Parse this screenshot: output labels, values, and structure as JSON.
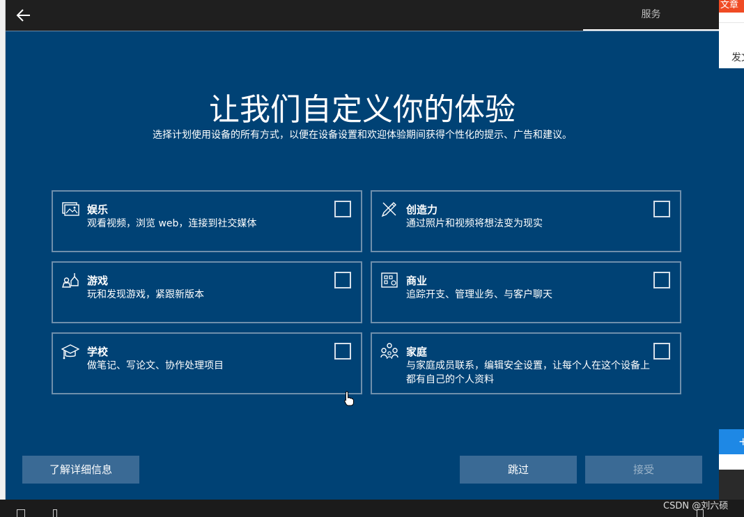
{
  "topbar": {
    "back_icon": "back-arrow-icon",
    "tab_label": "服务"
  },
  "oobe": {
    "title": "让我们自定义你的体验",
    "subtitle": "选择计划使用设备的所有方式，以便在设备设置和欢迎体验期间获得个性化的提示、广告和建议。",
    "cards": [
      {
        "icon": "entertainment-icon",
        "title": "娱乐",
        "desc": "观看视频，浏览 web，连接到社交媒体",
        "checked": false
      },
      {
        "icon": "creativity-icon",
        "title": "创造力",
        "desc": "通过照片和视频将想法变为现实",
        "checked": false
      },
      {
        "icon": "gaming-icon",
        "title": "游戏",
        "desc": "玩和发现游戏，紧跟新版本",
        "checked": false
      },
      {
        "icon": "business-icon",
        "title": "商业",
        "desc": "追踪开支、管理业务、与客户聊天",
        "checked": false
      },
      {
        "icon": "school-icon",
        "title": "学校",
        "desc": "做笔记、写论文、协作处理项目",
        "checked": false
      },
      {
        "icon": "family-icon",
        "title": "家庭",
        "desc": "与家庭成员联系，编辑安全设置，让每个人在这个设备上都有自己的个人资料",
        "checked": false
      }
    ],
    "buttons": {
      "learn_more": "了解详细信息",
      "skip": "跳过",
      "accept": "接受"
    }
  },
  "right_panel": {
    "top_text": "文章",
    "text": "发文",
    "button_text": "+"
  },
  "watermark": "CSDN @刘六硕",
  "colors": {
    "background": "#004275",
    "button": "#3a6a95",
    "card_border": "#6f8fac",
    "topbar": "#1f1f1f"
  }
}
